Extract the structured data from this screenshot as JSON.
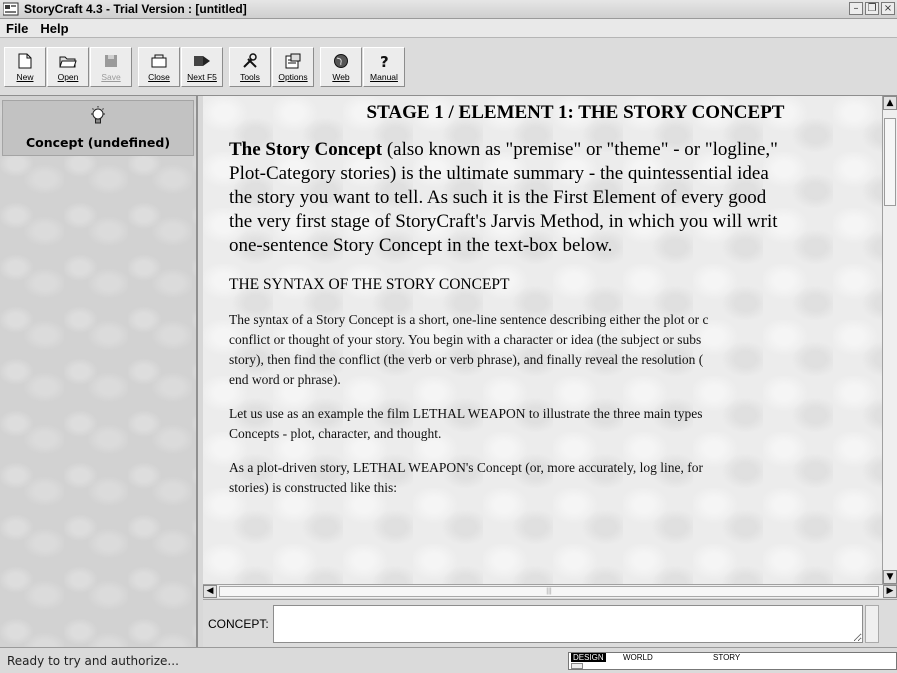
{
  "window": {
    "title": "StoryCraft 4.3 - Trial Version : [untitled]",
    "buttons": [
      "minimize-icon",
      "restore-icon",
      "close-icon"
    ]
  },
  "menu": [
    "File",
    "Help"
  ],
  "toolbar": {
    "new": "New",
    "open": "Open",
    "save": "Save",
    "close": "Close",
    "next": "Next F5",
    "tools": "Tools",
    "options": "Options",
    "web": "Web",
    "manual": "Manual"
  },
  "sidebar": {
    "items": [
      {
        "label": "Concept (undefined)",
        "icon": "lightbulb-icon"
      }
    ]
  },
  "content": {
    "title": "STAGE 1 / ELEMENT 1:  THE STORY CONCEPT",
    "intro_bold": "The Story Concept",
    "intro_line1_rest": " (also known as \"premise\" or \"theme\" - or \"logline,\"",
    "intro_line2": "Plot-Category stories) is the ultimate summary - the quintessential idea",
    "intro_line3": "the story you want to tell.  As such it is the First Element of every good",
    "intro_line4": "the very first stage of StoryCraft's Jarvis Method, in which you will writ",
    "intro_line5": "one-sentence Story Concept in the text-box below.",
    "section_heading": "THE SYNTAX OF THE STORY CONCEPT",
    "para1": [
      "The syntax of a Story Concept is a short, one-line sentence describing either the plot or c",
      "conflict or thought of your story.  You begin with a character or idea (the subject or subs",
      "story), then find the conflict (the verb or verb phrase), and finally reveal the resolution (",
      "end word or phrase)."
    ],
    "para2": [
      "Let us use as an example the film LETHAL WEAPON to illustrate the three main types",
      "Concepts - plot, character, and thought."
    ],
    "para3": [
      "As a plot-driven story, LETHAL WEAPON's Concept (or, more accurately, log line, for",
      "stories) is constructed like this:"
    ]
  },
  "concept": {
    "label": "CONCEPT:",
    "value": ""
  },
  "status": {
    "text": "Ready to try and authorize...",
    "modes": [
      "DESIGN",
      "WORLD",
      "STORY"
    ],
    "active_mode": "DESIGN"
  }
}
